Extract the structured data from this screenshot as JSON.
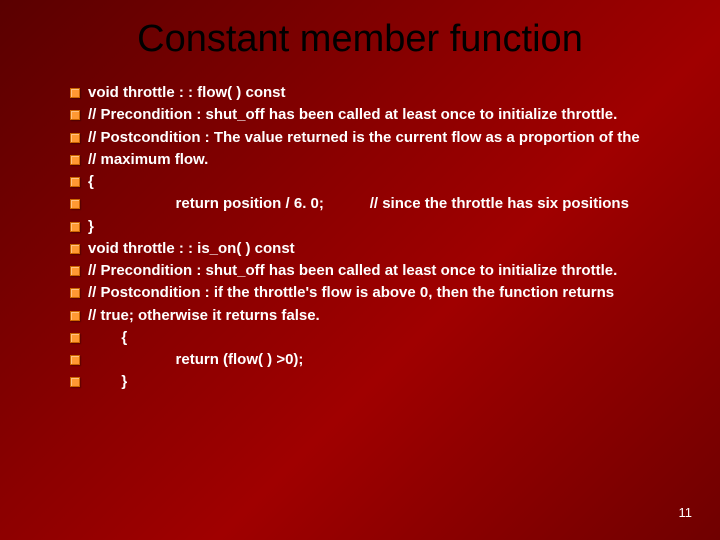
{
  "title": "Constant member function",
  "lines": [
    "void  throttle : : flow( ) const",
    "//  Precondition : shut_off has been called at least once to initialize throttle.",
    "//  Postcondition : The value returned is the current flow as a proportion of the",
    "//  maximum flow.",
    "{",
    "                     return position / 6. 0;           // since the throttle has six positions",
    "}",
    "void  throttle : : is_on( ) const",
    "//  Precondition : shut_off has been called at least once to initialize throttle.",
    "//  Postcondition : if the throttle's flow is above 0, then the function returns",
    "//  true; otherwise it returns false.",
    "        {",
    "                     return (flow( ) >0);",
    "        }"
  ],
  "page_number": "11"
}
